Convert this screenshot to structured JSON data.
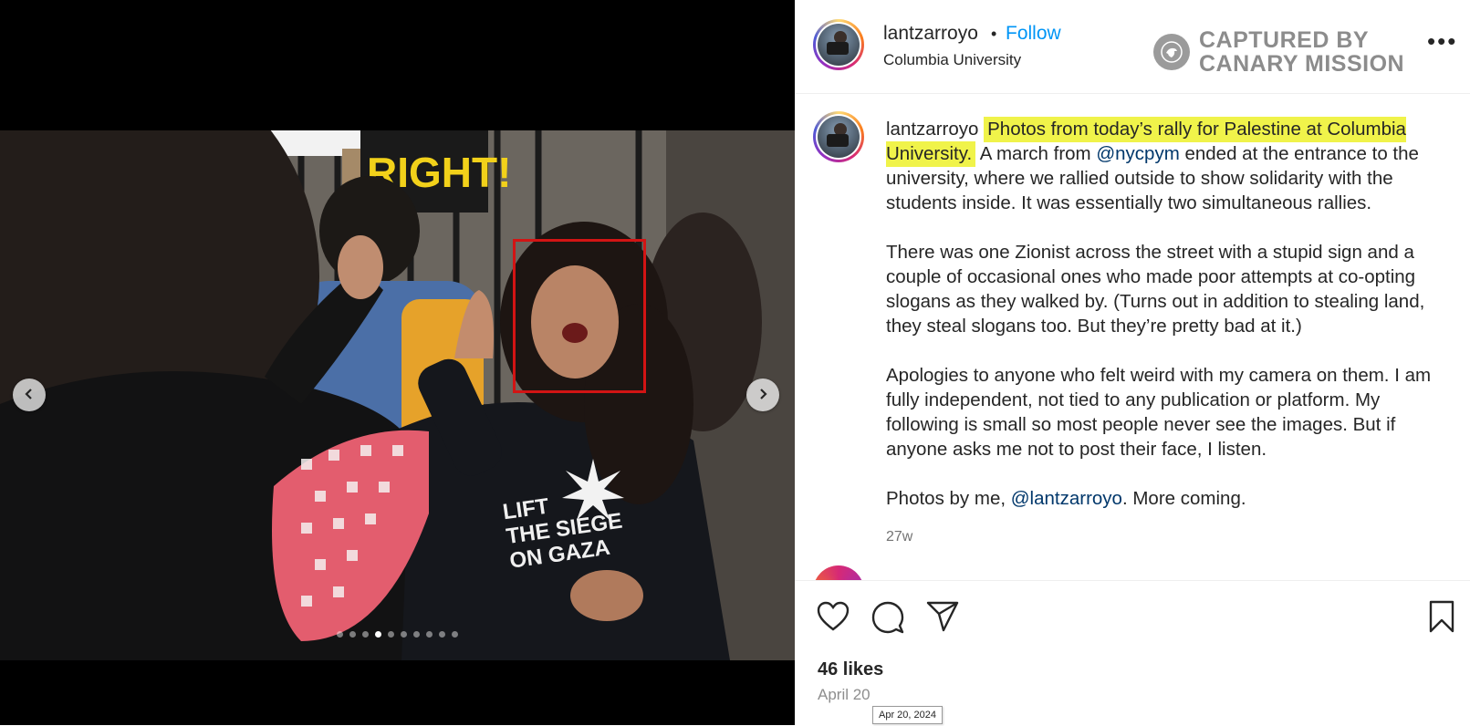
{
  "media": {
    "carousel_total": 10,
    "carousel_active_index": 3
  },
  "header": {
    "username": "lantzarroyo",
    "separator": "•",
    "follow_label": "Follow",
    "location": "Columbia University",
    "more_label": "•••"
  },
  "watermark": {
    "line1": "CAPTURED BY",
    "line2": "CANARY MISSION"
  },
  "caption": {
    "username": "lantzarroyo",
    "highlight": "Photos from today’s rally for Palestine at Columbia University.",
    "p1_a": " A march from ",
    "p1_mention": "@nycpym",
    "p1_b": " ended at the entrance to the university, where we rallied outside to show solidarity with the students inside. It was essentially two simultaneous rallies.",
    "p2": "There was one Zionist across the street with a stupid sign and a couple of occasional ones who made poor attempts at co-opting slogans as they walked by. (Turns out in addition to stealing land, they steal slogans too. But they’re pretty bad at it.)",
    "p3": "Apologies to anyone who felt weird with my camera on them. I am fully independent, not tied to any publication or platform. My following is small so most people never see the images. But if anyone asks me not to post their face, I listen.",
    "p4_a": "Photos by me, ",
    "p4_mention": "@lantzarroyo",
    "p4_b": ". More coming.",
    "time_ago": "27w"
  },
  "actions": {
    "likes": "46 likes",
    "date": "April 20",
    "date_tooltip": "Apr 20, 2024"
  },
  "colors": {
    "follow": "#0095f6",
    "mention": "#00376b",
    "highlight": "#f0f34a",
    "annotation_box": "#d21414"
  },
  "icons": [
    "chevron-left-icon",
    "chevron-right-icon",
    "heart-icon",
    "comment-icon",
    "share-icon",
    "bookmark-icon",
    "more-icon",
    "canary-logo-icon"
  ],
  "photo_text": {
    "shirt_line1": "LIFT",
    "shirt_line2": "THE SIEGE",
    "shirt_line3": "ON GAZA",
    "sign_text": "RIGHT!"
  }
}
